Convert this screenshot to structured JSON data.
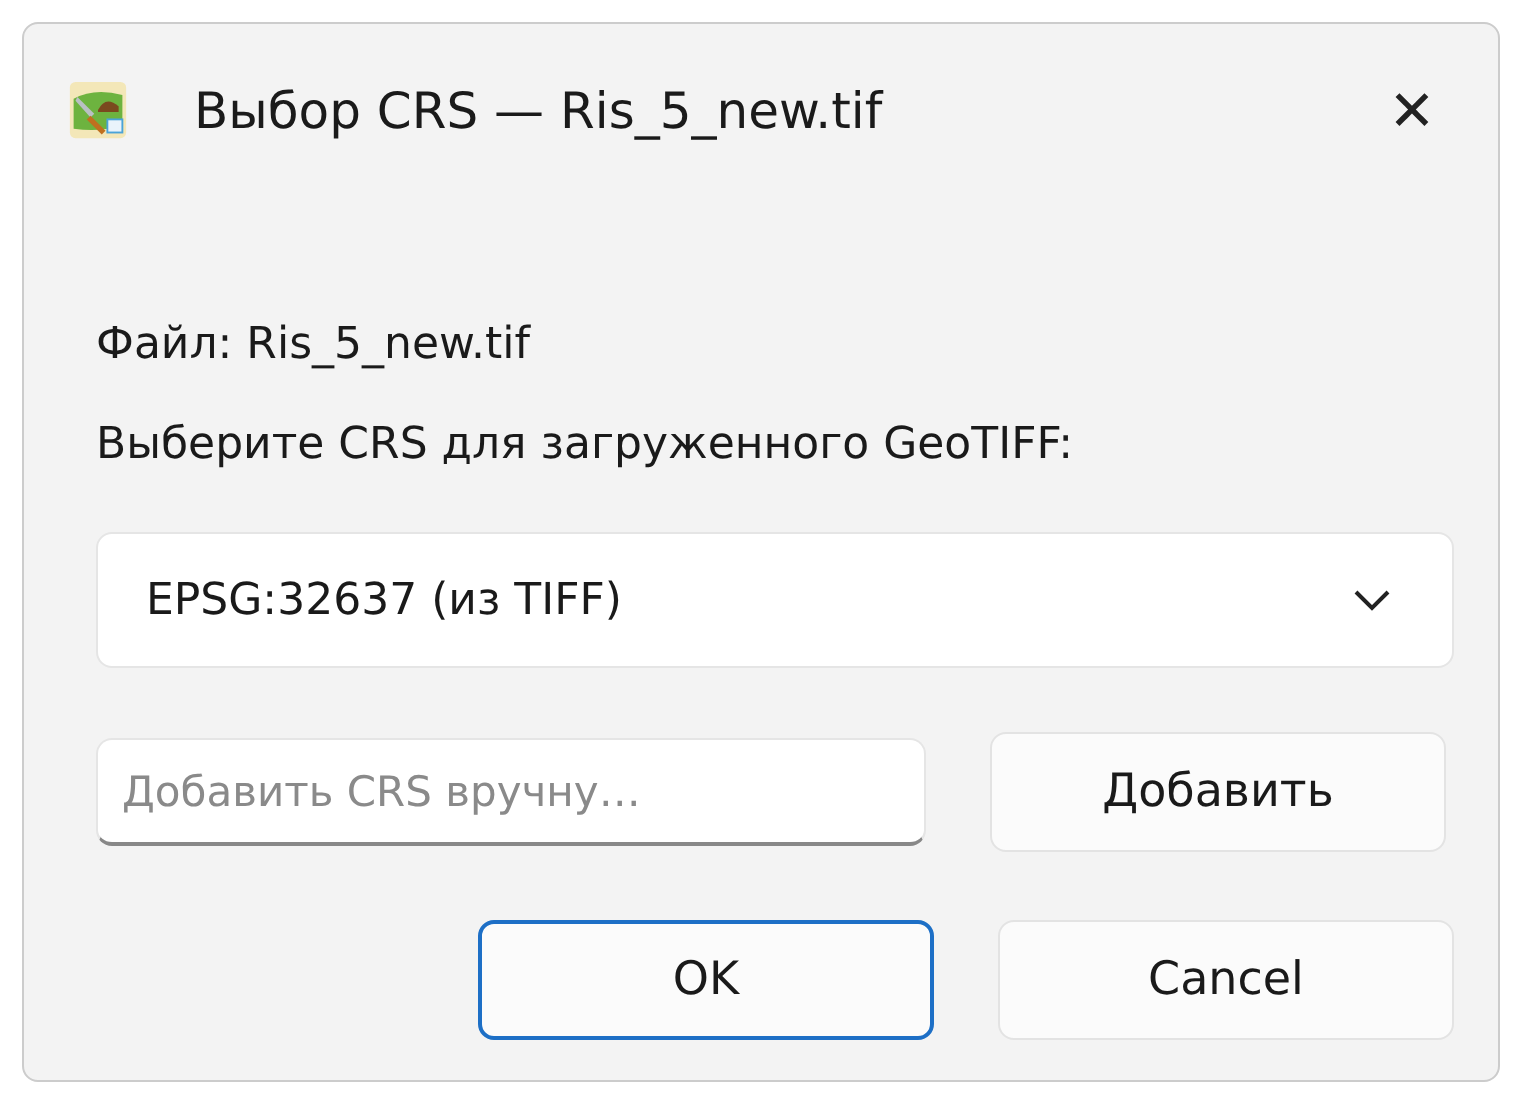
{
  "window": {
    "title": "Выбор CRS — Ris_5_new.tif",
    "close": "✕"
  },
  "file_label": "Файл: Ris_5_new.tif",
  "prompt": "Выберите CRS для загруженного GeoTIFF:",
  "crs_select": {
    "value": "EPSG:32637 (из TIFF)"
  },
  "manual_crs": {
    "placeholder": "Добавить CRS вручну…"
  },
  "add_button": "Добавить",
  "buttons": [
    {
      "label": "OK",
      "default": true
    },
    {
      "label": "Cancel",
      "default": false
    }
  ]
}
